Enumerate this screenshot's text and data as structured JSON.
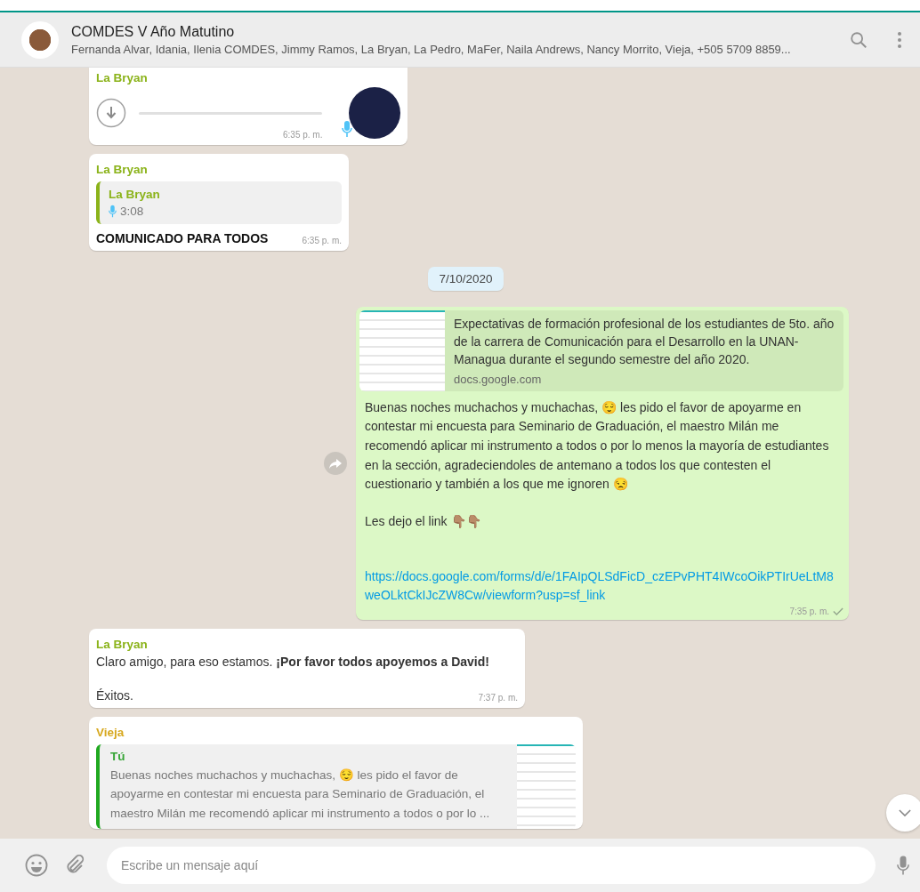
{
  "header": {
    "title": "COMDES V Año Matutino",
    "subtitle": "Fernanda Alvar, Idania, Ilenia COMDES, Jimmy Ramos, La Bryan, La Pedro, MaFer, Naila Andrews, Nancy Morrito, Vieja, +505 5709 8859..."
  },
  "messages": [
    {
      "kind": "voice",
      "sender": "La Bryan",
      "time": "6:35 p. m."
    },
    {
      "kind": "quote_voice",
      "sender": "La Bryan",
      "quote_sender": "La Bryan",
      "duration": "3:08",
      "text": "COMUNICADO PARA TODOS",
      "time": "6:35 p. m."
    },
    {
      "kind": "date",
      "text": "7/10/2020"
    },
    {
      "kind": "link",
      "preview_title": "Expectativas de formación profesional de los estudiantes de 5to. año de la carrera de Comunicación para el Desarrollo en la UNAN-Managua durante el segundo semestre del año 2020.",
      "preview_domain": "docs.google.com",
      "text": "Buenas noches muchachos y muchachas, 😌 les pido el favor de apoyarme en contestar mi encuesta para Seminario de Graduación, el maestro Milán me recomendó aplicar mi instrumento a todos o por lo menos la mayoría de estudiantes en la sección, agradeciendoles de antemano a todos los que contesten el cuestionario y también a los que me ignoren 😒",
      "text2": "Les dejo el link 👇🏽👇🏽",
      "url": "https://docs.google.com/forms/d/e/1FAIpQLSdFicD_czEPvPHT4IWcoOikPTIrUeLtM8weOLktCkIJcZW8Cw/viewform?usp=sf_link",
      "time": "7:35 p. m.",
      "read": false
    },
    {
      "kind": "text",
      "sender": "La Bryan",
      "text": "Claro amigo, para eso estamos. **¡Por favor todos apoyemos a David!**",
      "text2": "Éxitos.",
      "time": "7:37 p. m."
    },
    {
      "kind": "quote_preview",
      "sender": "Vieja",
      "quote_sender": "Tú",
      "quote_text": "Buenas noches muchachos y muchachas, 😌 les pido el favor de apoyarme en contestar mi encuesta para Seminario de Graduación, el maestro Milán me recomendó aplicar mi instrumento a todos o por lo ..."
    }
  ],
  "composer": {
    "placeholder": "Escribe un mensaje aquí"
  }
}
